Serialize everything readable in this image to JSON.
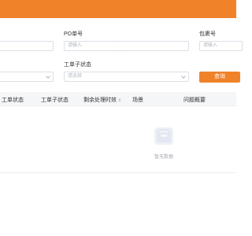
{
  "colors": {
    "accent": "#f0822a",
    "header_bg": "#f5f6f8",
    "border": "#dcdfe6",
    "placeholder": "#b3b7bf"
  },
  "filters": {
    "po_label": "PO单号",
    "po_placeholder": "请输入",
    "pkg_label": "包裹号",
    "pkg_placeholder": "请输入",
    "substatus_label": "工单子状态",
    "substatus_placeholder": "请选择"
  },
  "query_button": "查询",
  "table": {
    "columns": [
      "工单状态",
      "工单子状态",
      "剩余处理时效",
      "场景",
      "问题概要"
    ],
    "sort_icon": "⇕",
    "rows": []
  },
  "empty": {
    "icon": "empty-box-icon",
    "text": "暂无数据"
  }
}
